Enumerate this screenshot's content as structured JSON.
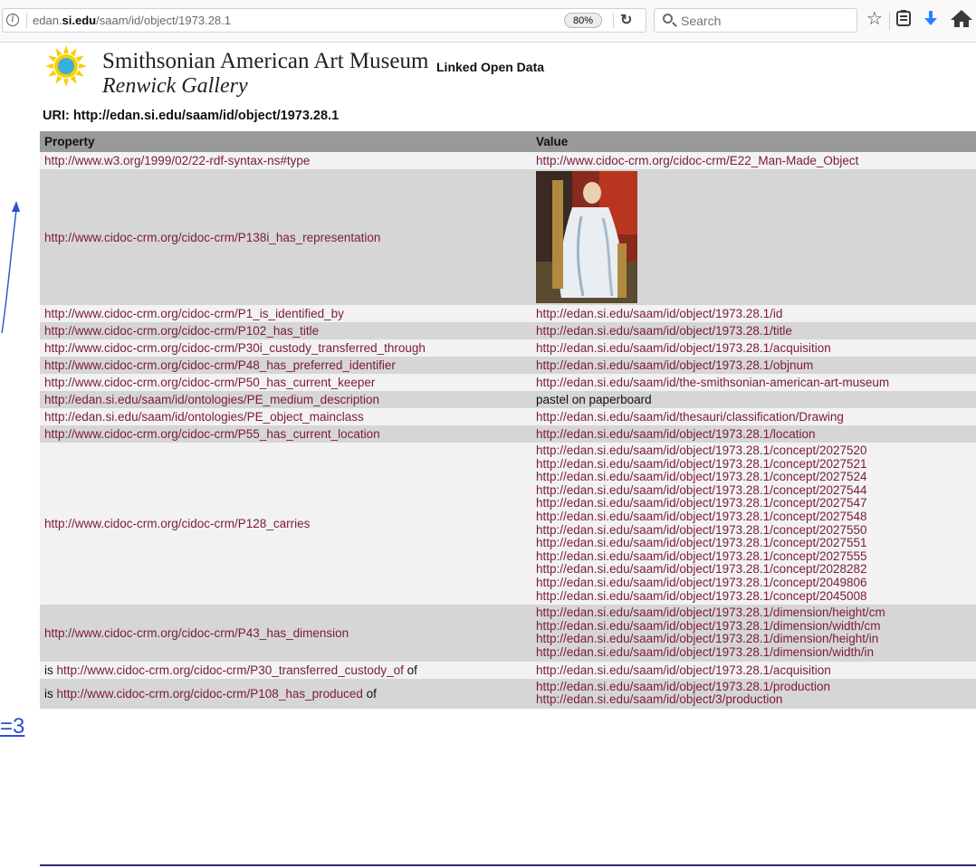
{
  "browser": {
    "url_prefix": "edan.",
    "url_domain": "si.edu",
    "url_path": "/saam/id/object/1973.28.1",
    "zoom": "80%",
    "search_placeholder": "Search"
  },
  "header": {
    "title": "Smithsonian American Art Museum",
    "subtitle": "Renwick Gallery",
    "tagline": "Linked Open Data",
    "uri_line": "URI: http://edan.si.edu/saam/id/object/1973.28.1"
  },
  "table": {
    "col_property": "Property",
    "col_value": "Value",
    "rows": [
      {
        "property": "http://www.w3.org/1999/02/22-rdf-syntax-ns#type",
        "values": [
          "http://www.cidoc-crm.org/cidoc-crm/E22_Man-Made_Object"
        ]
      },
      {
        "property": "http://www.cidoc-crm.org/cidoc-crm/P138i_has_representation",
        "image": "painting-thumbnail"
      },
      {
        "property": "http://www.cidoc-crm.org/cidoc-crm/P1_is_identified_by",
        "values": [
          "http://edan.si.edu/saam/id/object/1973.28.1/id"
        ]
      },
      {
        "property": "http://www.cidoc-crm.org/cidoc-crm/P102_has_title",
        "values": [
          "http://edan.si.edu/saam/id/object/1973.28.1/title"
        ]
      },
      {
        "property": "http://www.cidoc-crm.org/cidoc-crm/P30i_custody_transferred_through",
        "values": [
          "http://edan.si.edu/saam/id/object/1973.28.1/acquisition"
        ]
      },
      {
        "property": "http://www.cidoc-crm.org/cidoc-crm/P48_has_preferred_identifier",
        "values": [
          "http://edan.si.edu/saam/id/object/1973.28.1/objnum"
        ]
      },
      {
        "property": "http://www.cidoc-crm.org/cidoc-crm/P50_has_current_keeper",
        "values": [
          "http://edan.si.edu/saam/id/the-smithsonian-american-art-museum"
        ]
      },
      {
        "property": "http://edan.si.edu/saam/id/ontologies/PE_medium_description",
        "plain_value": "pastel on paperboard"
      },
      {
        "property": "http://edan.si.edu/saam/id/ontologies/PE_object_mainclass",
        "values": [
          "http://edan.si.edu/saam/id/thesauri/classification/Drawing"
        ]
      },
      {
        "property": "http://www.cidoc-crm.org/cidoc-crm/P55_has_current_location",
        "values": [
          "http://edan.si.edu/saam/id/object/1973.28.1/location"
        ]
      },
      {
        "property": "http://www.cidoc-crm.org/cidoc-crm/P128_carries",
        "values": [
          "http://edan.si.edu/saam/id/object/1973.28.1/concept/2027520",
          "http://edan.si.edu/saam/id/object/1973.28.1/concept/2027521",
          "http://edan.si.edu/saam/id/object/1973.28.1/concept/2027524",
          "http://edan.si.edu/saam/id/object/1973.28.1/concept/2027544",
          "http://edan.si.edu/saam/id/object/1973.28.1/concept/2027547",
          "http://edan.si.edu/saam/id/object/1973.28.1/concept/2027548",
          "http://edan.si.edu/saam/id/object/1973.28.1/concept/2027550",
          "http://edan.si.edu/saam/id/object/1973.28.1/concept/2027551",
          "http://edan.si.edu/saam/id/object/1973.28.1/concept/2027555",
          "http://edan.si.edu/saam/id/object/1973.28.1/concept/2028282",
          "http://edan.si.edu/saam/id/object/1973.28.1/concept/2049806",
          "http://edan.si.edu/saam/id/object/1973.28.1/concept/2045008"
        ]
      },
      {
        "property": "http://www.cidoc-crm.org/cidoc-crm/P43_has_dimension",
        "values": [
          "http://edan.si.edu/saam/id/object/1973.28.1/dimension/height/cm",
          "http://edan.si.edu/saam/id/object/1973.28.1/dimension/width/cm",
          "http://edan.si.edu/saam/id/object/1973.28.1/dimension/height/in",
          "http://edan.si.edu/saam/id/object/1973.28.1/dimension/width/in"
        ]
      },
      {
        "prefix": "is ",
        "property": "http://www.cidoc-crm.org/cidoc-crm/P30_transferred_custody_of",
        "suffix": " of",
        "values": [
          "http://edan.si.edu/saam/id/object/1973.28.1/acquisition"
        ]
      },
      {
        "prefix": "is ",
        "property": "http://www.cidoc-crm.org/cidoc-crm/P108_has_produced",
        "suffix": " of",
        "values": [
          "http://edan.si.edu/saam/id/object/1973.28.1/production",
          "http://edan.si.edu/saam/id/object/3/production"
        ]
      }
    ]
  },
  "annotation": {
    "text": "=3"
  },
  "colors": {
    "link": "#7b1a3a",
    "header_row": "#999999",
    "row_light": "#f2f2f2",
    "row_dark": "#d6d6d6",
    "annotation_blue": "#2b4fd6"
  }
}
